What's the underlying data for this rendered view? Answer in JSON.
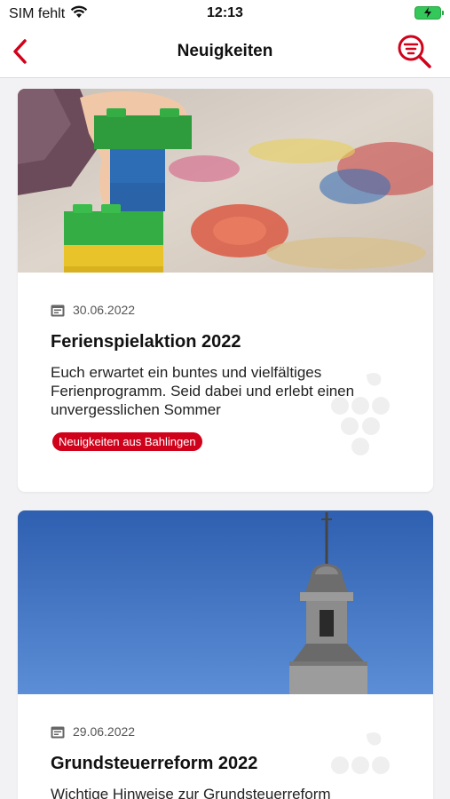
{
  "status_bar": {
    "carrier": "SIM fehlt",
    "time": "12:13",
    "wifi_icon": "wifi-icon",
    "battery_icon": "battery-charging-icon"
  },
  "nav": {
    "title": "Neuigkeiten",
    "back_icon": "chevron-left-icon",
    "filter_icon": "search-filter-icon"
  },
  "colors": {
    "accent": "#d0021b",
    "battery": "#34c759"
  },
  "news": [
    {
      "image": "lego-blocks-toys-photo",
      "date_icon": "calendar-icon",
      "date": "30.06.2022",
      "title": "Ferienspielaktion 2022",
      "teaser": "Euch erwartet ein buntes und vielfältiges Ferienprogramm. Seid dabei und erlebt einen unvergesslichen Sommer",
      "category": "Neuigkeiten aus Bahlingen"
    },
    {
      "image": "church-tower-blue-sky-photo",
      "date_icon": "calendar-icon",
      "date": "29.06.2022",
      "title": "Grundsteuerreform 2022",
      "teaser": "Wichtige Hinweise zur Grundsteuerreform"
    }
  ]
}
